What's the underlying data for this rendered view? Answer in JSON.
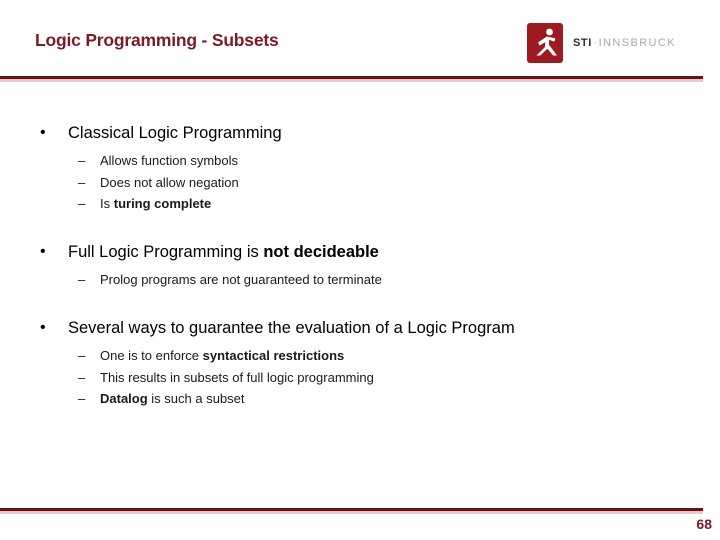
{
  "header": {
    "title": "Logic Programming - Subsets",
    "logo": {
      "icon_name": "sti-person-icon",
      "abbr": "STI",
      "separator": "·",
      "place": "INNSBRUCK"
    }
  },
  "theme": {
    "accent_dark": "#6e0f14",
    "accent_light": "#e9c9cc",
    "title_color": "#7a1b28",
    "logo_red": "#9e1b22",
    "body_text": "#000000"
  },
  "markers": {
    "level1": "•",
    "level2": "–"
  },
  "content": {
    "blocks": [
      {
        "heading": {
          "plain": "Classical Logic Programming",
          "bold": ""
        },
        "sub_items": [
          {
            "plain": "Allows function symbols",
            "bold": ""
          },
          {
            "plain": "Does not allow negation",
            "bold": ""
          },
          {
            "plain": "Is ",
            "bold": "turing complete",
            "tail": ""
          }
        ]
      },
      {
        "heading": {
          "plain": "Full Logic Programming is ",
          "bold": "not decideable"
        },
        "sub_items": [
          {
            "plain": "Prolog programs are not guaranteed to terminate",
            "bold": ""
          }
        ]
      },
      {
        "heading": {
          "plain": "Several ways to guarantee the evaluation of a Logic Program",
          "bold": ""
        },
        "sub_items": [
          {
            "plain": "One is to enforce ",
            "bold": "syntactical restrictions",
            "tail": ""
          },
          {
            "plain": "This results in subsets of full logic programming",
            "bold": ""
          },
          {
            "plain": "",
            "bold": "Datalog",
            "tail": " is such a subset"
          }
        ]
      }
    ]
  },
  "footer": {
    "page_number": "68"
  }
}
